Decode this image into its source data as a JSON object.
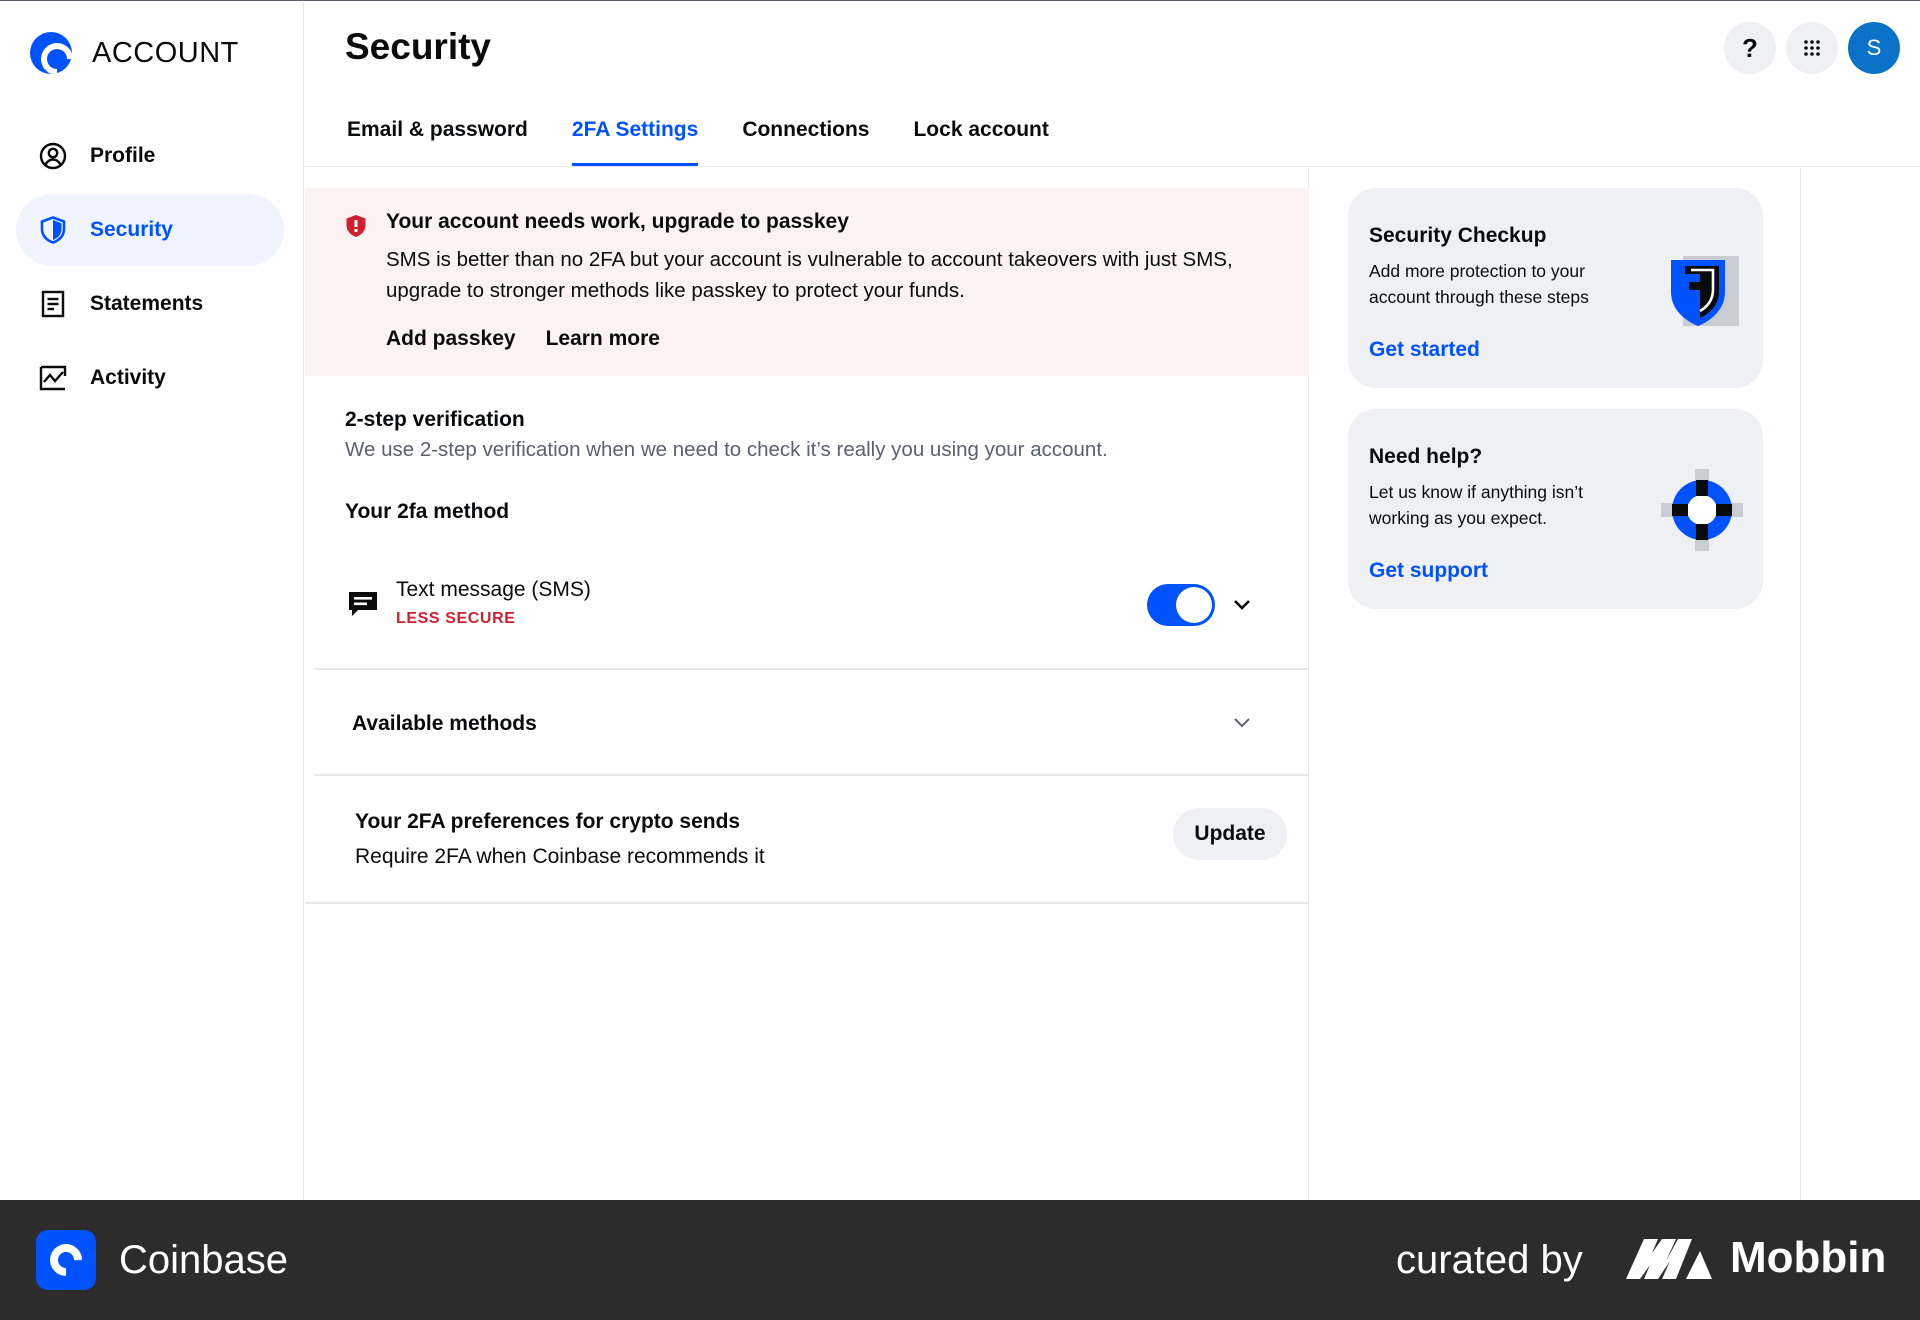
{
  "brand": {
    "title": "ACCOUNT"
  },
  "sidebar": {
    "items": [
      {
        "label": "Profile",
        "icon": "user-circle-icon",
        "active": false
      },
      {
        "label": "Security",
        "icon": "shield-icon",
        "active": true
      },
      {
        "label": "Statements",
        "icon": "document-icon",
        "active": false
      },
      {
        "label": "Activity",
        "icon": "activity-chart-icon",
        "active": false
      }
    ]
  },
  "header": {
    "title": "Security",
    "tabs": [
      {
        "label": "Email & password",
        "active": false
      },
      {
        "label": "2FA Settings",
        "active": true
      },
      {
        "label": "Connections",
        "active": false
      },
      {
        "label": "Lock account",
        "active": false
      }
    ],
    "help_label": "?",
    "avatar_initial": "S"
  },
  "alert": {
    "title": "Your account needs work, upgrade to passkey",
    "body": "SMS is better than no 2FA but your account is vulnerable to account takeovers with just SMS, upgrade to stronger methods like passkey to protect your funds.",
    "add_passkey_label": "Add passkey",
    "learn_more_label": "Learn more"
  },
  "verification": {
    "title": "2-step verification",
    "description": "We use 2-step verification when we need to check it’s really you using your account.",
    "method_heading": "Your 2fa method",
    "method": {
      "name": "Text message (SMS)",
      "badge": "LESS SECURE",
      "enabled": true
    },
    "available_label": "Available methods"
  },
  "preferences": {
    "title": "Your 2FA preferences for crypto sends",
    "description": "Require 2FA when Coinbase recommends it",
    "button_label": "Update"
  },
  "cards": [
    {
      "title": "Security Checkup",
      "description": "Add more protection to your account through these steps",
      "link": "Get started",
      "art": "shield-art-icon"
    },
    {
      "title": "Need help?",
      "description": "Let us know if anything isn’t working as you expect.",
      "link": "Get support",
      "art": "lifebuoy-icon"
    }
  ],
  "footer": {
    "app_name": "Coinbase",
    "curated_by": "curated by",
    "brand": "Mobbin"
  },
  "colors": {
    "accent": "#0052ff",
    "alert_bg": "#fdf2f2",
    "danger": "#cf202f",
    "card_bg": "#eef0f3",
    "footer_bg": "#2c2c2c"
  }
}
